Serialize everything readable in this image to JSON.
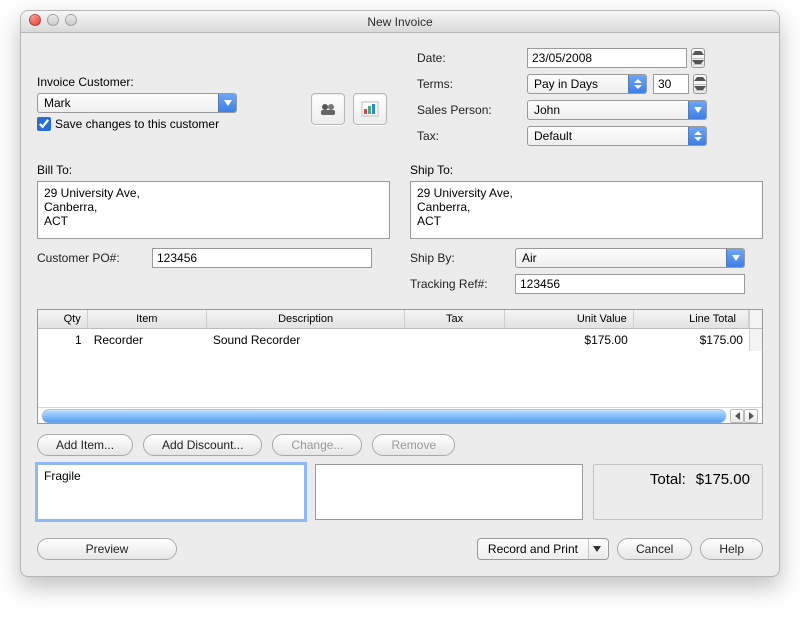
{
  "window": {
    "title": "New Invoice"
  },
  "left": {
    "invoice_customer_label": "Invoice Customer:",
    "customer": "Mark",
    "save_changes_label": "Save changes to this customer",
    "save_changes_checked": true
  },
  "header": {
    "date_label": "Date:",
    "date": "23/05/2008",
    "terms_label": "Terms:",
    "terms": "Pay in Days",
    "terms_days": "30",
    "sales_label": "Sales Person:",
    "sales_person": "John",
    "tax_label": "Tax:",
    "tax": "Default"
  },
  "bill": {
    "label": "Bill To:",
    "address": "29 University Ave,\nCanberra,\nACT"
  },
  "ship": {
    "label": "Ship To:",
    "address": "29 University Ave,\nCanberra,\nACT"
  },
  "po": {
    "label": "Customer PO#:",
    "value": "123456"
  },
  "shipby": {
    "label": "Ship By:",
    "value": "Air"
  },
  "tracking": {
    "label": "Tracking Ref#:",
    "value": "123456"
  },
  "table": {
    "headers": {
      "qty": "Qty",
      "item": "Item",
      "desc": "Description",
      "tax": "Tax",
      "uv": "Unit Value",
      "lt": "Line Total"
    },
    "rows": [
      {
        "qty": "1",
        "item": "Recorder",
        "desc": "Sound Recorder",
        "tax": "",
        "uv": "$175.00",
        "lt": "$175.00"
      }
    ]
  },
  "buttons": {
    "add_item": "Add Item...",
    "add_discount": "Add Discount...",
    "change": "Change...",
    "remove": "Remove",
    "preview": "Preview",
    "record": "Record and Print",
    "cancel": "Cancel",
    "help": "Help"
  },
  "notes": {
    "note1": "Fragile",
    "note2": ""
  },
  "total": {
    "label": "Total:",
    "value": "$175.00"
  },
  "icons": {
    "people": "people-icon",
    "chart": "chart-icon"
  }
}
